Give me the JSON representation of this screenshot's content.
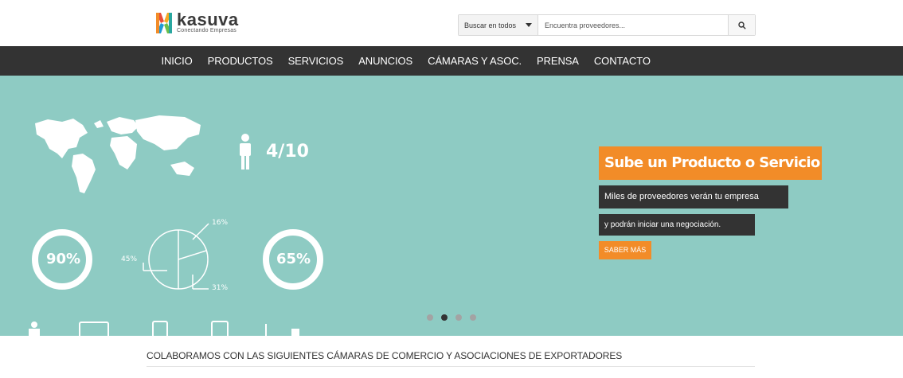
{
  "brand": {
    "name": "kasuva",
    "tagline": "Conectando Empresas"
  },
  "search": {
    "category": "Buscar en todos",
    "placeholder": "Encuentra proveedores...",
    "button_icon": "search-icon"
  },
  "nav": {
    "items": [
      "INICIO",
      "PRODUCTOS",
      "SERVICIOS",
      "ANUNCIOS",
      "CÁMARAS Y ASOC.",
      "PRENSA",
      "CONTACTO"
    ]
  },
  "hero": {
    "stat_ratio": "4/10",
    "donut_left": "90%",
    "donut_right": "65%",
    "pie_labels": [
      "16%",
      "45%",
      "31%"
    ],
    "cta_title": "Sube un Producto o Servicio",
    "cta_line1": "Miles de proveedores verán tu empresa",
    "cta_line2": "y podrán iniciar una negociación.",
    "cta_button": "SABER MÁS",
    "slides_count": 4,
    "active_slide": 2
  },
  "section": {
    "collab_title": "COLABORAMOS CON LAS SIGUIENTES CÁMARAS DE COMERCIO Y ASOCIACIONES DE EXPORTADORES"
  },
  "colors": {
    "nav_bg": "#333333",
    "hero_bg": "#8ecbc3",
    "accent": "#f28c28"
  }
}
